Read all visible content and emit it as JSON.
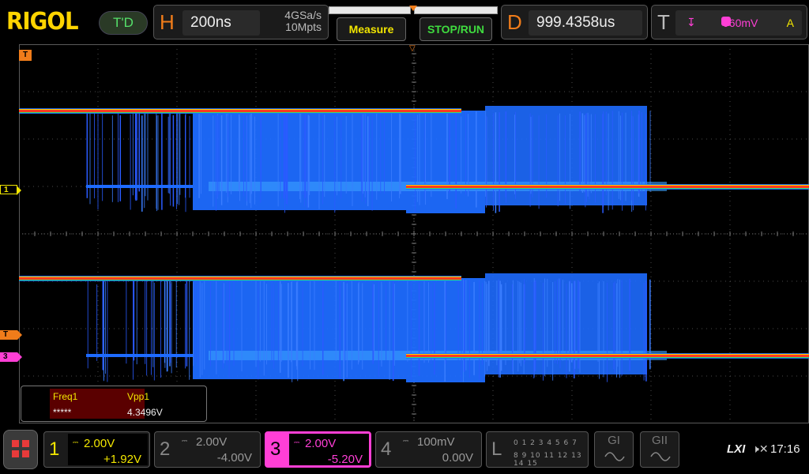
{
  "brand": {
    "logo": "RIGOL",
    "trigger_state": "T'D"
  },
  "horizontal": {
    "letter": "H",
    "timebase": "200ns",
    "sample_rate": "4GSa/s",
    "memory_depth": "10Mpts",
    "position_marker_fraction": 0.5
  },
  "buttons": {
    "measure": "Measure",
    "stop_run": "STOP/RUN"
  },
  "delay": {
    "letter": "D",
    "value": "999.4358us"
  },
  "trigger": {
    "letter": "T",
    "slope_icon": "falling-edge-icon",
    "level": "960mV",
    "mode": "A"
  },
  "markers": {
    "trigger_position": "T",
    "ch1": "1",
    "trigger_level": "T",
    "ch3": "3"
  },
  "measurements": {
    "items": [
      {
        "label": "Freq1",
        "value": "*****"
      },
      {
        "label": "Vpp1",
        "value": "4.3496V"
      }
    ]
  },
  "channels": [
    {
      "num": "1",
      "scale": "2.00V",
      "offset": "+1.92V",
      "coupling": "DC",
      "active": true,
      "color": "#f2e600"
    },
    {
      "num": "2",
      "scale": "2.00V",
      "offset": "-4.00V",
      "coupling": "DC",
      "active": false,
      "color": "#888888"
    },
    {
      "num": "3",
      "scale": "2.00V",
      "offset": "-5.20V",
      "coupling": "DC",
      "active": true,
      "color": "#ff3fd6"
    },
    {
      "num": "4",
      "scale": "100mV",
      "offset": "0.00V",
      "coupling": "DC",
      "active": false,
      "color": "#888888"
    }
  ],
  "logic": {
    "letter": "L",
    "row1": "0 1 2 3  4 5 6 7",
    "row2": "8 9 10 11 12 13 14 15"
  },
  "generators": [
    {
      "label": "GI"
    },
    {
      "label": "GII"
    }
  ],
  "status": {
    "lxi": "LXI",
    "speaker_icon": "speaker-muted-icon",
    "time": "17:16"
  },
  "colors": {
    "accent_orange": "#f07c1a",
    "ch1_yellow": "#f2e600",
    "ch3_magenta": "#ff3fd6",
    "trace_blue": "#1e6bff",
    "run_green": "#3fdc3f"
  }
}
